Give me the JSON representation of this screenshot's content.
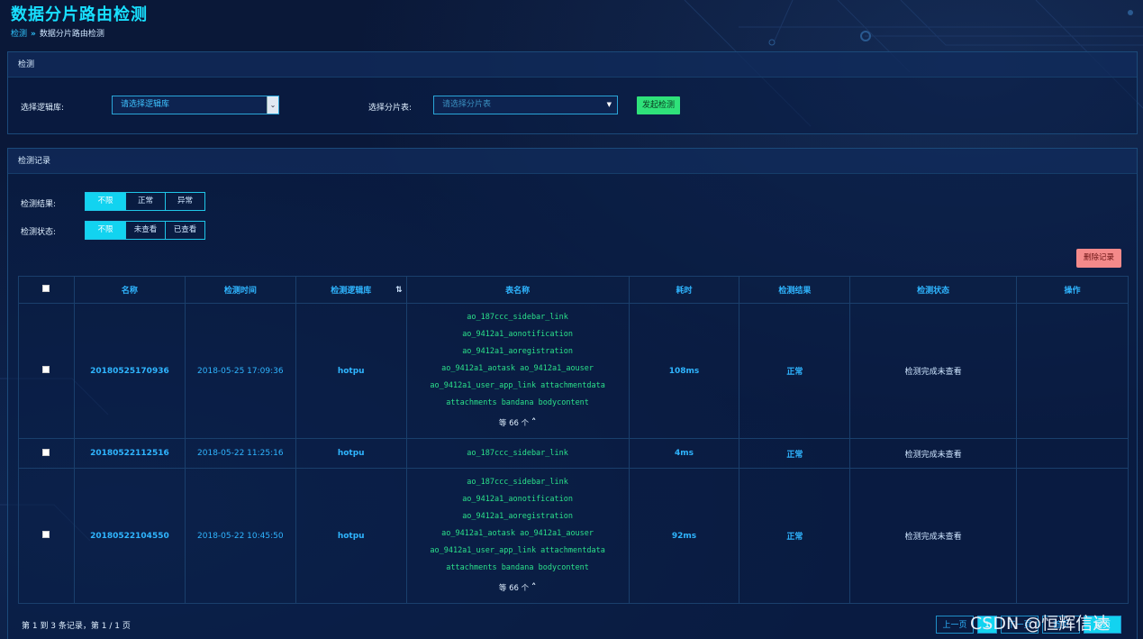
{
  "page": {
    "title": "数据分片路由检测",
    "breadcrumb": [
      "检测",
      "数据分片路由检测"
    ],
    "breadcrumb_sep": "»"
  },
  "panel_detect": {
    "heading": "检测",
    "db_label": "选择逻辑库:",
    "db_placeholder": "请选择逻辑库",
    "table_label": "选择分片表:",
    "table_placeholder": "请选择分片表",
    "start_button": "发起检测"
  },
  "panel_records": {
    "heading": "检测记录",
    "result_filter": {
      "label": "检测结果:",
      "options": [
        "不限",
        "正常",
        "异常"
      ],
      "selected": "不限"
    },
    "status_filter": {
      "label": "检测状态:",
      "options": [
        "不限",
        "未查看",
        "已查看"
      ],
      "selected": "不限"
    },
    "delete_button": "删除记录"
  },
  "table": {
    "columns": [
      "名称",
      "检测时间",
      "检测逻辑库",
      "表名称",
      "耗时",
      "检测结果",
      "检测状态",
      "操作"
    ],
    "rows": [
      {
        "name": "20180525170936",
        "time": "2018-05-25 17:09:36",
        "lib": "hotpu",
        "tables": [
          "ao_187ccc_sidebar_link",
          "ao_9412a1_aonotification",
          "ao_9412a1_aoregistration",
          "ao_9412a1_aotask  ao_9412a1_aouser",
          "ao_9412a1_user_app_link  attachmentdata",
          "attachments  bandana  bodycontent"
        ],
        "more": "等 66 个",
        "duration": "108ms",
        "result": "正常",
        "status": "检测完成未查看"
      },
      {
        "name": "20180522112516",
        "time": "2018-05-22 11:25:16",
        "lib": "hotpu",
        "tables": [
          "ao_187ccc_sidebar_link"
        ],
        "more": "",
        "duration": "4ms",
        "result": "正常",
        "status": "检测完成未查看"
      },
      {
        "name": "20180522104550",
        "time": "2018-05-22 10:45:50",
        "lib": "hotpu",
        "tables": [
          "ao_187ccc_sidebar_link",
          "ao_9412a1_aonotification",
          "ao_9412a1_aoregistration",
          "ao_9412a1_aotask  ao_9412a1_aouser",
          "ao_9412a1_user_app_link  attachmentdata",
          "attachments  bandana  bodycontent"
        ],
        "more": "等 66 个",
        "duration": "92ms",
        "result": "正常",
        "status": "检测完成未查看"
      }
    ]
  },
  "footer": {
    "summary": "第 1 到 3 条记录，第 1 / 1 页",
    "prev": "上一页",
    "next": "下一页",
    "first": "首页",
    "last": "尾页",
    "current_page": "1"
  },
  "watermark": "CSDN @恒辉信达",
  "colors": {
    "accent": "#18e0ff",
    "green": "#2fe27a",
    "red": "#f48a8a",
    "mono_green": "#2be08a"
  }
}
